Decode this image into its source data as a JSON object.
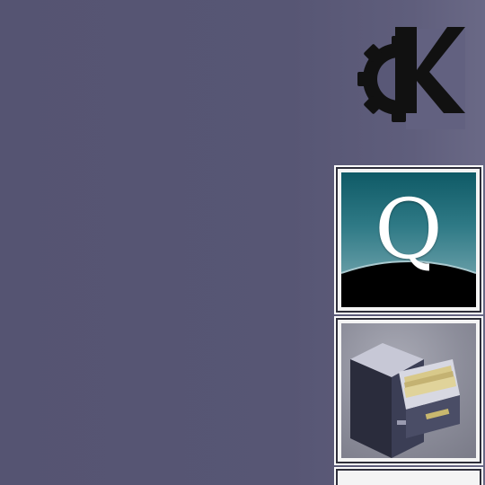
{
  "desktop": {
    "background": "#575674"
  },
  "logo": {
    "icon": "kde-gear-k-icon",
    "color": "#111111"
  },
  "panel": {
    "tiles": [
      {
        "icon": "quanta-q-icon",
        "letter": "Q",
        "accent": "#1b6a75"
      },
      {
        "icon": "file-cabinet-icon",
        "accent": "#8c8d9a"
      },
      {
        "icon": "partial-panel-icon"
      }
    ]
  }
}
